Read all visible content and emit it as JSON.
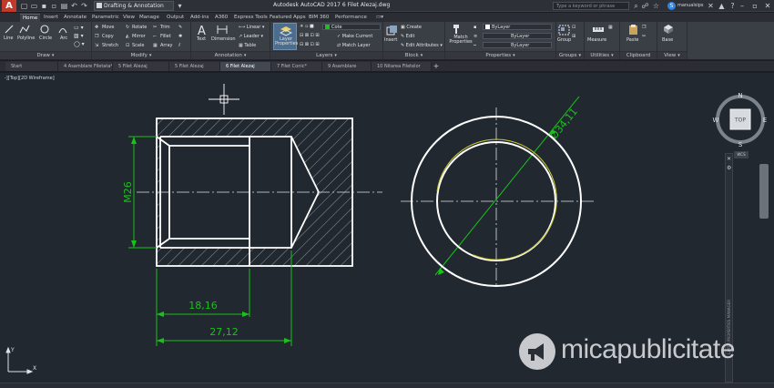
{
  "titlebar": {
    "app_logo": "A",
    "workspace": "Drafting & Annotation",
    "title": "Autodesk AutoCAD 2017   6 Filet Alezaj.dwg",
    "search_placeholder": "Type a keyword or phrase",
    "user": "manualsips",
    "user_badge": "S"
  },
  "ribbon_tabs": [
    "Home",
    "Insert",
    "Annotate",
    "Parametric",
    "View",
    "Manage",
    "Output",
    "Add-ins",
    "A360",
    "Express Tools",
    "Featured Apps",
    "BIM 360",
    "Performance"
  ],
  "ribbon": {
    "draw": {
      "line": "Line",
      "polyline": "Polyline",
      "circle": "Circle",
      "arc": "Arc",
      "panel": "Draw"
    },
    "modify": {
      "move": "Move",
      "rotate": "Rotate",
      "trim": "Trim",
      "copy": "Copy",
      "mirror": "Mirror",
      "fillet": "Fillet",
      "stretch": "Stretch",
      "scale": "Scale",
      "array": "Array",
      "panel": "Modify"
    },
    "annotation": {
      "text": "Text",
      "dimension": "Dimension",
      "linear": "Linear",
      "leader": "Leader",
      "table": "Table",
      "panel": "Annotation"
    },
    "layers": {
      "layer_properties": "Layer Properties",
      "layer_name": "Cote",
      "make_current": "Make Current",
      "match_layer": "Match Layer",
      "panel": "Layers"
    },
    "block": {
      "insert": "Insert",
      "create": "Create",
      "edit": "Edit",
      "edit_attributes": "Edit Attributes",
      "panel": "Block"
    },
    "properties": {
      "match_properties": "Match Properties",
      "bylayer1": "ByLayer",
      "bylayer2": "ByLayer",
      "bylayer3": "ByLayer",
      "panel": "Properties"
    },
    "groups": {
      "group": "Group",
      "panel": "Groups"
    },
    "utilities": {
      "measure": "Measure",
      "panel": "Utilities"
    },
    "clipboard": {
      "paste": "Paste",
      "panel": "Clipboard"
    },
    "view": {
      "base": "Base",
      "panel": "View"
    }
  },
  "file_tabs": [
    "Start",
    "4 Asamblare Filetata*",
    "5 Filet Alezaj",
    "5 Filet Alezaj",
    "6 Filet Alezaj",
    "7 Filet Conic*",
    "9 Asamblare",
    "10 Nitarea Filetelor"
  ],
  "active_file_tab": 4,
  "viewport_label": "-][Top][2D Wireframe]",
  "dimensions": {
    "thread": "M26",
    "length_short": "18,16",
    "length_long": "27,12",
    "diameter": "Ø34,11"
  },
  "viewcube": {
    "north": "N",
    "south": "S",
    "east": "E",
    "west": "W",
    "face": "TOP",
    "wcs": "WCS"
  },
  "navbar_text": "LAYER PROPERTIES MANAGER",
  "ucs": {
    "x": "X",
    "y": "Y"
  },
  "watermark": "micapublicitate",
  "colors": {
    "geometry": "#ffffff",
    "dimension": "#19c219",
    "hatch": "#9aa0a8",
    "centerline": "#dfe2e6",
    "thread_arc": "#c8c832",
    "background": "#212830"
  }
}
